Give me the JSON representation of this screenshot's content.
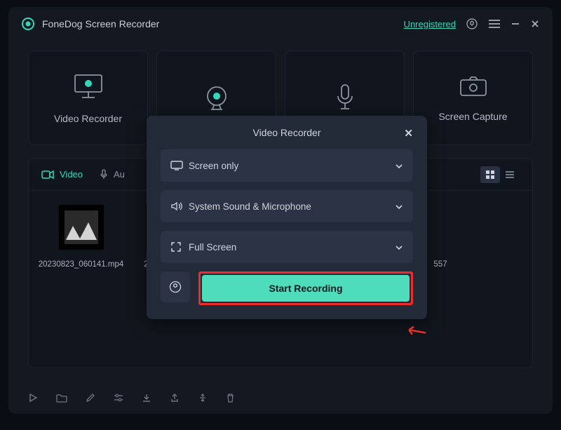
{
  "app": {
    "title": "FoneDog Screen Recorder",
    "unregistered": "Unregistered"
  },
  "modes": [
    {
      "label": "Video Recorder"
    },
    {
      "label": ""
    },
    {
      "label": ""
    },
    {
      "label": "Screen Capture"
    }
  ],
  "library": {
    "tabs": {
      "video": "Video",
      "audio": "Au"
    },
    "files": [
      {
        "name": "20230823_060141.mp4"
      },
      {
        "name": "2023"
      },
      {
        "name": ""
      },
      {
        "name": "557"
      }
    ]
  },
  "modal": {
    "title": "Video Recorder",
    "screen": "Screen only",
    "audio": "System Sound & Microphone",
    "area": "Full Screen",
    "start": "Start Recording"
  }
}
